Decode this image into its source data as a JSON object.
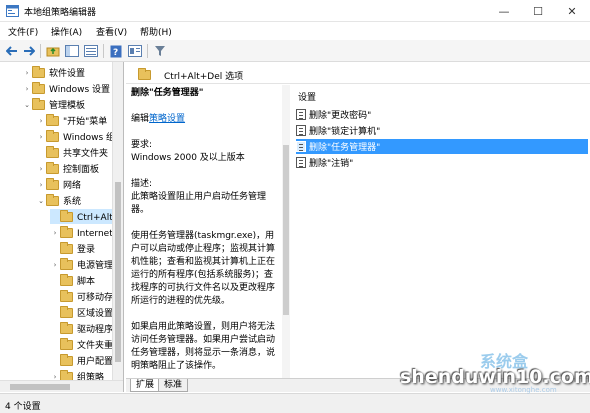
{
  "window": {
    "title": "本地组策略编辑器",
    "min": "—",
    "max": "☐",
    "close": "✕"
  },
  "menu": [
    "文件(F)",
    "操作(A)",
    "查看(V)",
    "帮助(H)"
  ],
  "tree": {
    "items": [
      {
        "label": "软件设置",
        "expander": "›"
      },
      {
        "label": "Windows 设置",
        "expander": "›"
      },
      {
        "label": "管理模板",
        "expander": "⌄"
      },
      {
        "label": "\"开始\"菜单",
        "expander": "›"
      },
      {
        "label": "Windows 组件",
        "expander": "›"
      },
      {
        "label": "共享文件夹",
        "expander": ""
      },
      {
        "label": "控制面板",
        "expander": "›"
      },
      {
        "label": "网络",
        "expander": "›"
      },
      {
        "label": "系统",
        "expander": "⌄"
      },
      {
        "label": "Ctrl+Alt+Del 选项",
        "expander": ""
      },
      {
        "label": "Internet 通信管理",
        "expander": "›"
      },
      {
        "label": "登录",
        "expander": ""
      },
      {
        "label": "电源管理",
        "expander": "›"
      },
      {
        "label": "脚本",
        "expander": ""
      },
      {
        "label": "可移动存储访问",
        "expander": ""
      },
      {
        "label": "区域设置服务",
        "expander": ""
      },
      {
        "label": "驱动程序安装",
        "expander": ""
      },
      {
        "label": "文件夹重定向",
        "expander": ""
      },
      {
        "label": "用户配置文件",
        "expander": ""
      },
      {
        "label": "组策略",
        "expander": "›"
      }
    ]
  },
  "header": {
    "title": "Ctrl+Alt+Del 选项"
  },
  "description": {
    "title": "删除\"任务管理器\"",
    "edit_prefix": "编辑",
    "edit_link": "策略设置",
    "body": "要求:\nWindows 2000 及以上版本\n\n描述:\n此策略设置阻止用户启动任务管理器。\n\n使用任务管理器(taskmgr.exe)，用户可以启动或停止程序；监视其计算机性能；查看和监视其计算机上正在运行的所有程序(包括系统服务)；查找程序的可执行文件名以及更改程序所运行的进程的优先级。\n\n如果启用此策略设置，则用户将无法访问任务管理器。如果用户尝试启动任务管理器，则将显示一条消息，说明策略阻止了该操作。"
  },
  "list": {
    "header": "设置",
    "items": [
      {
        "label": "删除\"更改密码\"",
        "selected": false
      },
      {
        "label": "删除\"锁定计算机\"",
        "selected": false
      },
      {
        "label": "删除\"任务管理器\"",
        "selected": true
      },
      {
        "label": "删除\"注销\"",
        "selected": false
      }
    ]
  },
  "tabs": {
    "expand": "扩展",
    "standard": "标准"
  },
  "status": {
    "text": "4 个设置"
  },
  "watermark": {
    "logo": "系统盒",
    "text": "shenduwin10.com",
    "url": "www.xitonghe.com"
  }
}
